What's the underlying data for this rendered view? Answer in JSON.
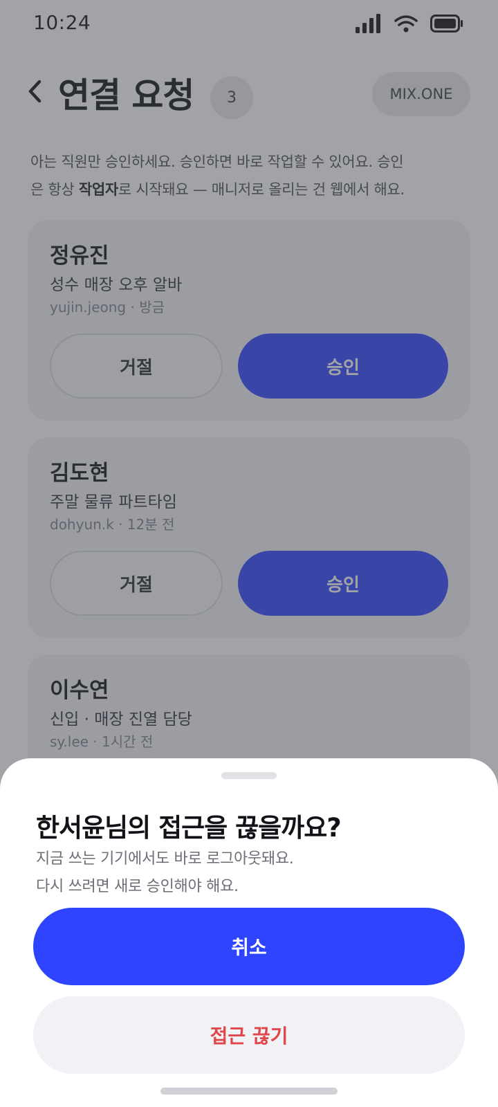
{
  "status_bar": {
    "time": "10:24",
    "icons": [
      "signal-icon",
      "wifi-icon",
      "battery-icon"
    ]
  },
  "header": {
    "back_icon": "chevron-left-icon",
    "title": "연결 요청",
    "count": "3",
    "workspace": "MIX.ONE"
  },
  "intro": {
    "line1": "아는 직원만 승인하세요. 승인하면 바로 작업할 수 있어요. 승인",
    "line2_pre": "은 항상 ",
    "line2_bold": "작업자",
    "line2_post": "로 시작돼요 — 매니저로 올리는 건 웹에서 해요."
  },
  "requests": [
    {
      "name": "정유진",
      "role": "성수 매장 오후 알바",
      "meta": "yujin.jeong · 방금",
      "reject": "거절",
      "approve": "승인"
    },
    {
      "name": "김도현",
      "role": "주말 물류 파트타임",
      "meta": "dohyun.k · 12분 전",
      "reject": "거절",
      "approve": "승인"
    },
    {
      "name": "이수연",
      "role": "신입 · 매장 진열 담당",
      "meta": "sy.lee · 1시간 전"
    }
  ],
  "sheet": {
    "title": "한서윤님의 접근을 끊을까요?",
    "desc_line1": "지금 쓰는 기기에서도 바로 로그아웃돼요.",
    "desc_line2": "다시 쓰려면 새로 승인해야 해요.",
    "cancel_label": "취소",
    "disconnect_label": "접근 끊기"
  },
  "colors": {
    "accent": "#2f44ff",
    "danger": "#e0464a",
    "overlay": "rgba(70,72,80,0.5)"
  }
}
